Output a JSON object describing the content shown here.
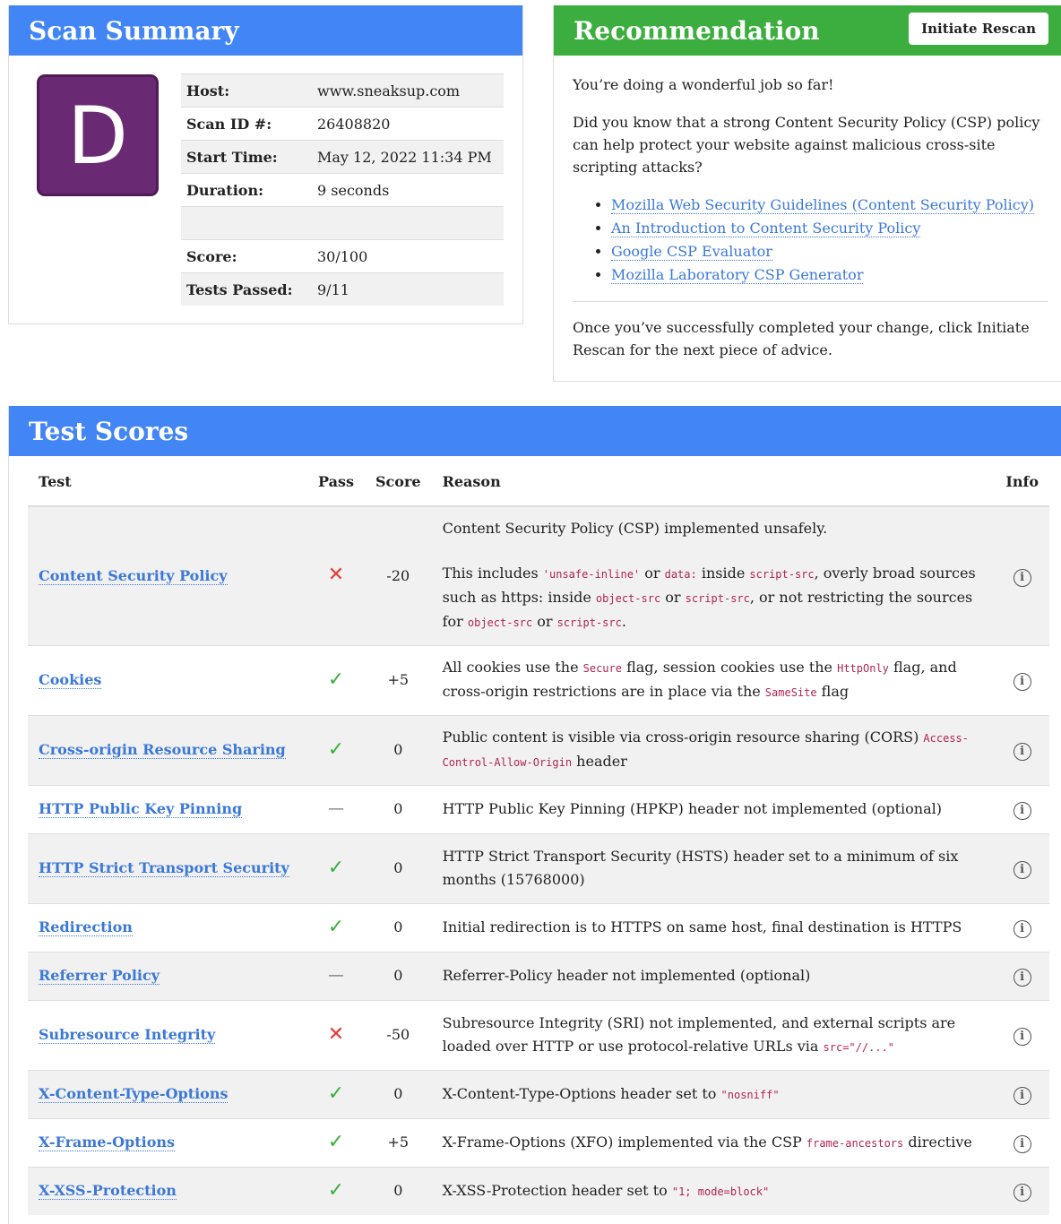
{
  "summary": {
    "title": "Scan Summary",
    "grade": "D",
    "rows": [
      {
        "key": "Host:",
        "value": "www.sneaksup.com"
      },
      {
        "key": "Scan ID #:",
        "value": "26408820"
      },
      {
        "key": "Start Time:",
        "value": "May 12, 2022 11:34 PM"
      },
      {
        "key": "Duration:",
        "value": "9 seconds"
      },
      {
        "key": "",
        "value": ""
      },
      {
        "key": "Score:",
        "value": "30/100"
      },
      {
        "key": "Tests Passed:",
        "value": "9/11"
      }
    ]
  },
  "recommendation": {
    "title": "Recommendation",
    "button_label": "Initiate Rescan",
    "intro": "You’re doing a wonderful job so far!",
    "body": "Did you know that a strong Content Security Policy (CSP) policy can help protect your website against malicious cross-site scripting attacks?",
    "links": [
      "Mozilla Web Security Guidelines (Content Security Policy)",
      "An Introduction to Content Security Policy",
      "Google CSP Evaluator",
      "Mozilla Laboratory CSP Generator"
    ],
    "footer": "Once you’ve successfully completed your change, click Initiate Rescan for the next piece of advice."
  },
  "tests": {
    "title": "Test Scores",
    "headers": {
      "test": "Test",
      "pass": "Pass",
      "score": "Score",
      "reason": "Reason",
      "info": "Info"
    },
    "rows": [
      {
        "name": "Content Security Policy",
        "pass": "fail",
        "score": "-20",
        "reason": [
          [
            [
              "t",
              "Content Security Policy (CSP) implemented unsafely."
            ]
          ],
          [
            [
              "t",
              "This includes "
            ],
            [
              "c",
              "'unsafe-inline'"
            ],
            [
              "t",
              " or "
            ],
            [
              "c",
              "data:"
            ],
            [
              "t",
              " inside "
            ],
            [
              "c",
              "script-src"
            ],
            [
              "t",
              ", overly broad sources such as https: inside "
            ],
            [
              "c",
              "object-src"
            ],
            [
              "t",
              " or "
            ],
            [
              "c",
              "script-src"
            ],
            [
              "t",
              ", or not restricting the sources for "
            ],
            [
              "c",
              "object-src"
            ],
            [
              "t",
              " or "
            ],
            [
              "c",
              "script-src"
            ],
            [
              "t",
              "."
            ]
          ]
        ]
      },
      {
        "name": "Cookies",
        "pass": "pass",
        "score": "+5",
        "reason": [
          [
            [
              "t",
              "All cookies use the "
            ],
            [
              "c",
              "Secure"
            ],
            [
              "t",
              " flag, session cookies use the "
            ],
            [
              "c",
              "HttpOnly"
            ],
            [
              "t",
              " flag, and cross-origin restrictions are in place via the "
            ],
            [
              "c",
              "SameSite"
            ],
            [
              "t",
              " flag"
            ]
          ]
        ]
      },
      {
        "name": "Cross-origin Resource Sharing",
        "pass": "pass",
        "score": "0",
        "reason": [
          [
            [
              "t",
              "Public content is visible via cross-origin resource sharing (CORS) "
            ],
            [
              "c",
              "Access-Control-Allow-Origin"
            ],
            [
              "t",
              " header"
            ]
          ]
        ]
      },
      {
        "name": "HTTP Public Key Pinning",
        "pass": "optional",
        "score": "0",
        "reason": [
          [
            [
              "t",
              "HTTP Public Key Pinning (HPKP) header not implemented (optional)"
            ]
          ]
        ]
      },
      {
        "name": "HTTP Strict Transport Security",
        "pass": "pass",
        "score": "0",
        "reason": [
          [
            [
              "t",
              "HTTP Strict Transport Security (HSTS) header set to a minimum of six months (15768000)"
            ]
          ]
        ]
      },
      {
        "name": "Redirection",
        "pass": "pass",
        "score": "0",
        "reason": [
          [
            [
              "t",
              "Initial redirection is to HTTPS on same host, final destination is HTTPS"
            ]
          ]
        ]
      },
      {
        "name": "Referrer Policy",
        "pass": "optional",
        "score": "0",
        "reason": [
          [
            [
              "t",
              "Referrer-Policy header not implemented (optional)"
            ]
          ]
        ]
      },
      {
        "name": "Subresource Integrity",
        "pass": "fail",
        "score": "-50",
        "reason": [
          [
            [
              "t",
              "Subresource Integrity (SRI) not implemented, and external scripts are loaded over HTTP or use protocol-relative URLs via "
            ],
            [
              "c",
              "src=\"//...\""
            ]
          ]
        ]
      },
      {
        "name": "X-Content-Type-Options",
        "pass": "pass",
        "score": "0",
        "reason": [
          [
            [
              "t",
              "X-Content-Type-Options header set to "
            ],
            [
              "c",
              "\"nosniff\""
            ]
          ]
        ]
      },
      {
        "name": "X-Frame-Options",
        "pass": "pass",
        "score": "+5",
        "reason": [
          [
            [
              "t",
              "X-Frame-Options (XFO) implemented via the CSP "
            ],
            [
              "c",
              "frame-ancestors"
            ],
            [
              "t",
              " directive"
            ]
          ]
        ]
      },
      {
        "name": "X-XSS-Protection",
        "pass": "pass",
        "score": "0",
        "reason": [
          [
            [
              "t",
              "X-XSS-Protection header set to "
            ],
            [
              "c",
              "\"1; mode=block\""
            ]
          ]
        ]
      }
    ]
  },
  "icons": {
    "pass": "check-icon",
    "fail": "x-icon",
    "optional": "dash-icon",
    "info": "info-icon"
  },
  "colors": {
    "blue_header": "#4285f4",
    "green_header": "#3cae3f",
    "grade_bg": "#6a2a73",
    "link": "#3b78d8",
    "code": "#b12554"
  }
}
